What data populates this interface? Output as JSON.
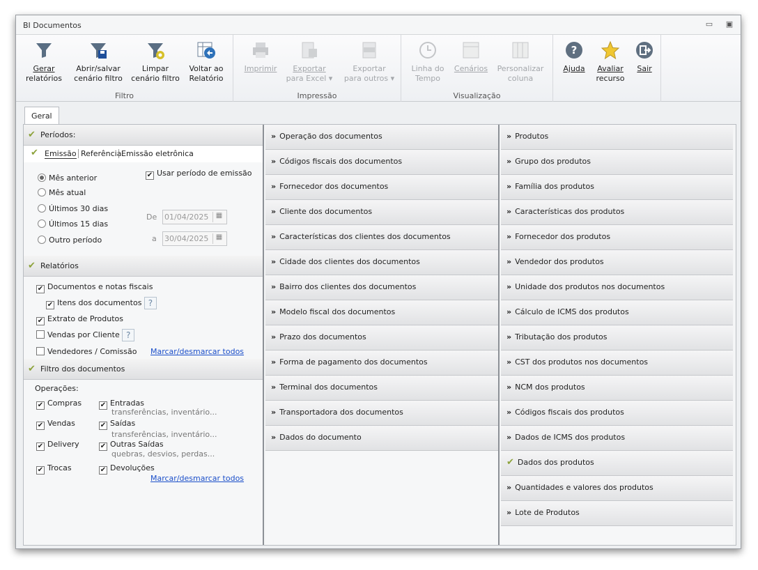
{
  "window": {
    "title": "BI Documentos"
  },
  "ribbon": {
    "groups": [
      {
        "label": "Filtro",
        "buttons": [
          {
            "line1": "Gerar",
            "line2": "relatórios",
            "icon": "funnel-icon",
            "disabled": false
          },
          {
            "line1": "Abrir/salvar",
            "line2": "cenário filtro",
            "icon": "funnel-save-icon",
            "disabled": false
          },
          {
            "line1": "Limpar",
            "line2": "cenário filtro",
            "icon": "funnel-clear-icon",
            "disabled": false
          },
          {
            "line1": "Voltar ao",
            "line2": "Relatório",
            "icon": "back-to-report-icon",
            "disabled": false
          }
        ]
      },
      {
        "label": "Impressão",
        "buttons": [
          {
            "line1": "Imprimir",
            "line2": "",
            "icon": "printer-icon",
            "disabled": true
          },
          {
            "line1": "Exportar",
            "line2": "para Excel ▾",
            "icon": "excel-export-icon",
            "disabled": true
          },
          {
            "line1": "Exportar",
            "line2": "para outros ▾",
            "icon": "txt-export-icon",
            "disabled": true
          }
        ]
      },
      {
        "label": "Visualização",
        "buttons": [
          {
            "line1": "Linha do",
            "line2": "Tempo",
            "icon": "clock-icon",
            "disabled": true
          },
          {
            "line1": "Cenários",
            "line2": "",
            "icon": "scenarios-icon",
            "disabled": true
          },
          {
            "line1": "Personalizar",
            "line2": "coluna",
            "icon": "columns-icon",
            "disabled": true
          }
        ]
      },
      {
        "label": "",
        "buttons": [
          {
            "line1": "Ajuda",
            "line2": "",
            "icon": "help-icon",
            "disabled": false
          },
          {
            "line1": "Avaliar",
            "line2": "recurso",
            "icon": "star-icon",
            "disabled": false
          },
          {
            "line1": "Sair",
            "line2": "",
            "icon": "exit-icon",
            "disabled": false
          }
        ]
      }
    ]
  },
  "tabs": {
    "geral": "Geral"
  },
  "periodos": {
    "header": "Períodos:",
    "subtabs": [
      "Emissão",
      "Referência",
      "Emissão eletrônica"
    ],
    "options": [
      "Mês anterior",
      "Mês atual",
      "Últimos 30 dias",
      "Últimos 15 dias",
      "Outro período"
    ],
    "selected": 0,
    "usar_periodo": "Usar período de emissão",
    "de_label": "De",
    "de_value": "01/04/2025",
    "a_label": "a",
    "a_value": "30/04/2025"
  },
  "relatorios": {
    "header": "Relatórios",
    "items": [
      "Documentos e notas fiscais",
      "Itens dos documentos",
      "Extrato de Produtos",
      "Vendas por Cliente",
      "Vendedores / Comissão"
    ],
    "checked": [
      true,
      true,
      true,
      false,
      false
    ],
    "link": "Marcar/desmarcar todos"
  },
  "filtro": {
    "header": "Filtro dos documentos",
    "operacoes_label": "Operações:",
    "left": [
      "Compras",
      "Vendas",
      "Delivery",
      "Trocas"
    ],
    "right": [
      "Entradas",
      "Saídas",
      "Outras Saídas",
      "Devoluções"
    ],
    "right_sub": [
      "transferências, inventário...",
      "transferências, inventário...",
      "quebras, desvios, perdas...",
      ""
    ],
    "link": "Marcar/desmarcar todos"
  },
  "documentos_list": [
    "Operação dos documentos",
    "Códigos fiscais dos documentos",
    "Fornecedor dos documentos",
    "Cliente dos documentos",
    "Características dos clientes dos documentos",
    "Cidade dos clientes dos documentos",
    "Bairro dos clientes dos documentos",
    "Modelo fiscal dos documentos",
    "Prazo dos documentos",
    "Forma de pagamento dos documentos",
    "Terminal dos documentos",
    "Transportadora dos documentos",
    "Dados do documento"
  ],
  "produtos_list": [
    "Produtos",
    "Grupo dos produtos",
    "Família dos produtos",
    "Características dos produtos",
    "Fornecedor dos produtos",
    "Vendedor dos produtos",
    "Unidade dos produtos nos documentos",
    "Cálculo de ICMS dos produtos",
    "Tributação dos produtos",
    "CST dos produtos nos documentos",
    "NCM dos produtos",
    "Códigos fiscais dos produtos",
    "Dados de ICMS dos produtos",
    "Dados dos produtos",
    "Quantidades e valores dos produtos",
    "Lote de Produtos"
  ],
  "produtos_checked_index": 13,
  "colors": {
    "check": "#8ca23a",
    "link": "#1a4ec9"
  }
}
